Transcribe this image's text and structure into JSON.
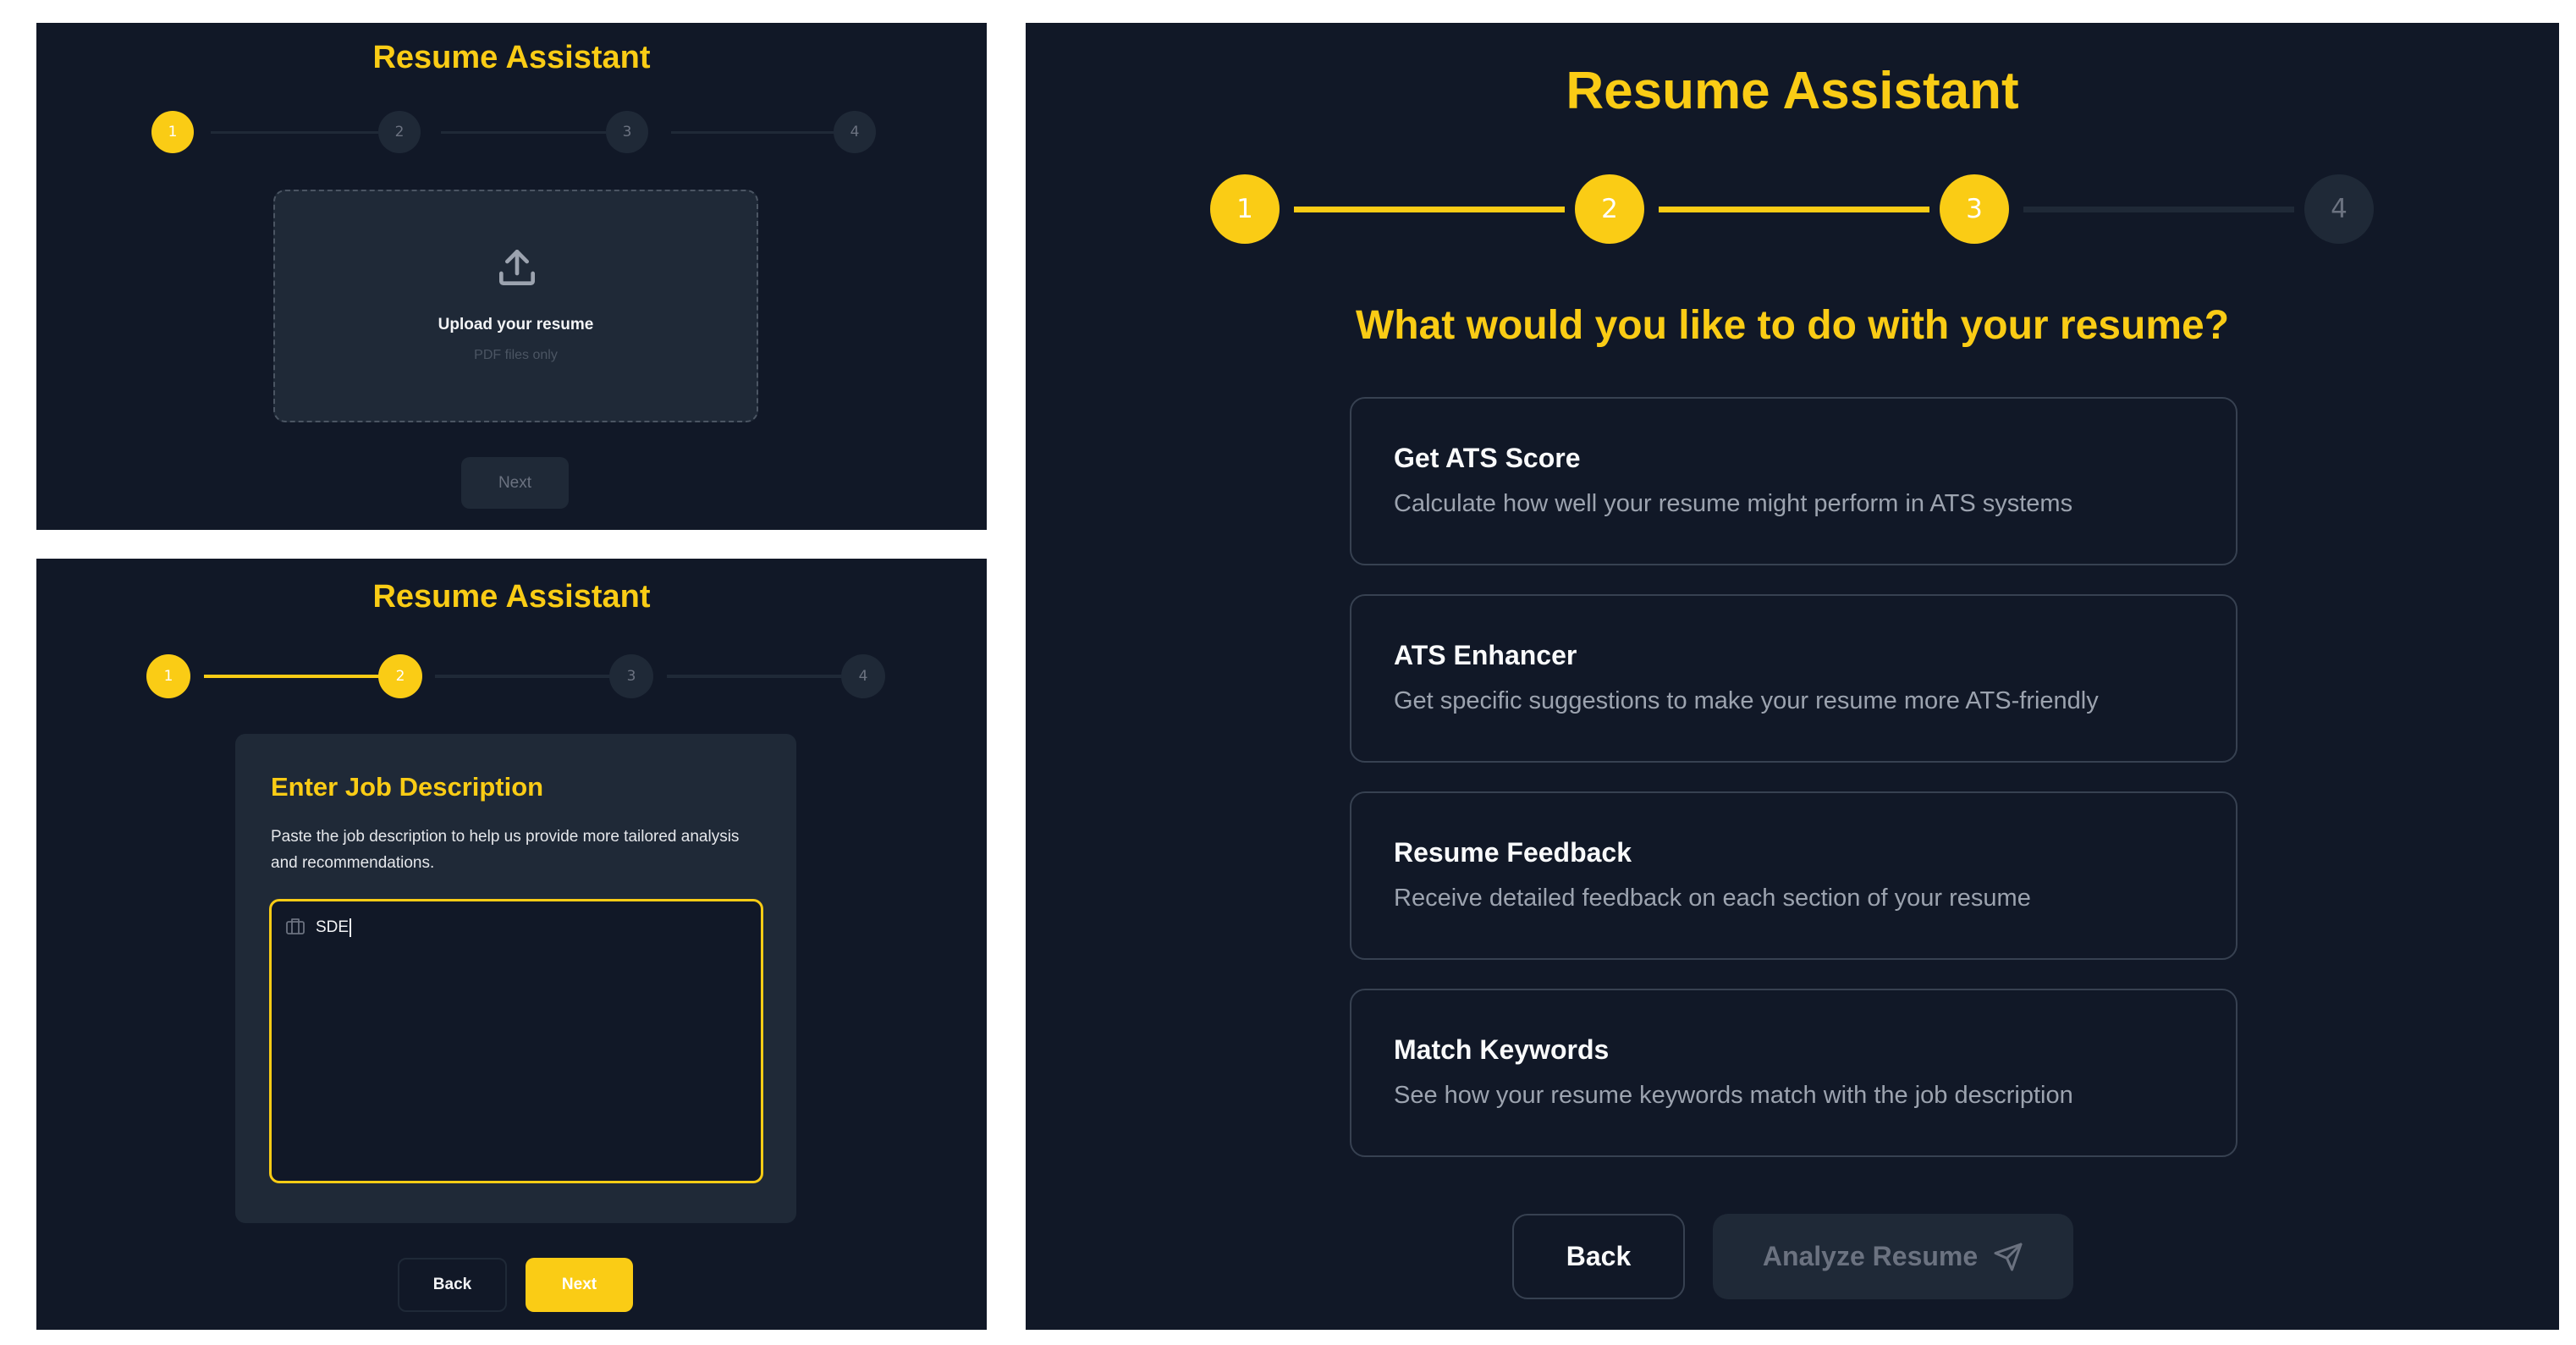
{
  "app": {
    "title": "Resume Assistant"
  },
  "stepper": {
    "steps": [
      "1",
      "2",
      "3",
      "4"
    ]
  },
  "upload_screen": {
    "current_step": 1,
    "upload_icon": "upload-icon",
    "dropzone_title": "Upload your resume",
    "dropzone_subtitle": "PDF files only",
    "next_label": "Next"
  },
  "job_description_screen": {
    "current_step": 2,
    "heading": "Enter Job Description",
    "description": "Paste the job description to help us provide more tailored analysis and recommendations.",
    "input_icon": "briefcase-icon",
    "input_value": "SDE",
    "back_label": "Back",
    "next_label": "Next"
  },
  "options_screen": {
    "current_step": 3,
    "question": "What would you like to do with your resume?",
    "options": [
      {
        "title": "Get ATS Score",
        "description": "Calculate how well your resume might perform in ATS systems"
      },
      {
        "title": "ATS Enhancer",
        "description": "Get specific suggestions to make your resume more ATS-friendly"
      },
      {
        "title": "Resume Feedback",
        "description": "Receive detailed feedback on each section of your resume"
      },
      {
        "title": "Match Keywords",
        "description": "See how your resume keywords match with the job description"
      }
    ],
    "back_label": "Back",
    "analyze_label": "Analyze Resume",
    "analyze_icon": "send-icon"
  },
  "colors": {
    "background": "#111827",
    "surface": "#1f2937",
    "accent": "#facc15",
    "muted_text": "#6b7280",
    "border": "#374151"
  }
}
